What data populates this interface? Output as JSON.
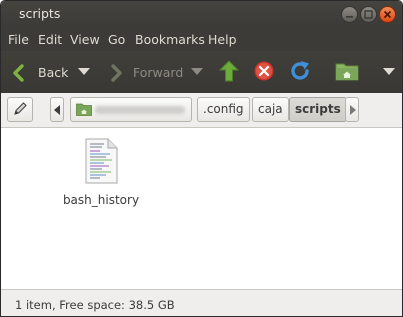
{
  "window": {
    "title": "scripts"
  },
  "menubar": {
    "items": [
      "File",
      "Edit",
      "View",
      "Go",
      "Bookmarks",
      "Help"
    ]
  },
  "toolbar": {
    "back_label": "Back",
    "forward_label": "Forward"
  },
  "locationbar": {
    "crumbs": [
      ".config",
      "caja",
      "scripts"
    ],
    "active_crumb": "scripts"
  },
  "files": [
    {
      "name": "bash_history",
      "icon": "text-file-icon"
    }
  ],
  "statusbar": {
    "text": "1 item, Free space: 38.5 GB"
  },
  "colors": {
    "titlebar": "#3c3b37",
    "close_button": "#dd4814",
    "green_arrow": "#6dab3c",
    "stop_red": "#d9493b",
    "reload_blue": "#3f8fd8",
    "folder_green": "#7aa65a"
  }
}
